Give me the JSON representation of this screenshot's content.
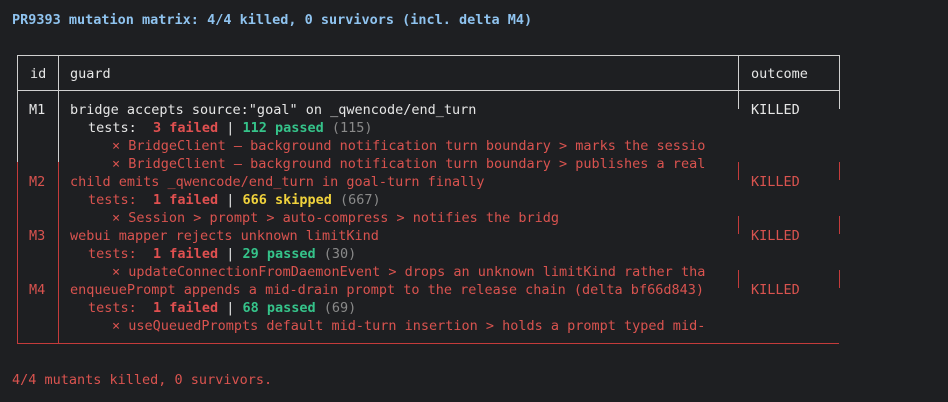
{
  "title": "PR9393 mutation matrix: 4/4 killed, 0 survivors (incl. delta M4)",
  "headers": {
    "id": "id",
    "guard": "guard",
    "outcome": "outcome"
  },
  "rows": [
    {
      "id": "M1",
      "guard": "bridge accepts source:\"goal\" on _qwencode/end_turn",
      "outcome": "KILLED",
      "tests_label": "tests:",
      "failed": "3 failed",
      "sep": "|",
      "second": "112 passed",
      "total": "(115)",
      "failures": [
        "× BridgeClient — background notification turn boundary > marks the sessio",
        "× BridgeClient — background notification turn boundary > publishes a real"
      ]
    },
    {
      "id": "M2",
      "guard": "child emits _qwencode/end_turn in goal-turn finally",
      "outcome": "KILLED",
      "tests_label": "tests:",
      "failed": "1 failed",
      "sep": "|",
      "second": "666 skipped",
      "total": "(667)",
      "failures": [
        "× Session > prompt > auto-compress > notifies the bridg"
      ]
    },
    {
      "id": "M3",
      "guard": "webui mapper rejects unknown limitKind",
      "outcome": "KILLED",
      "tests_label": "tests:",
      "failed": "1 failed",
      "sep": "|",
      "second": "29 passed",
      "total": "(30)",
      "failures": [
        "× updateConnectionFromDaemonEvent > drops an unknown limitKind rather tha"
      ]
    },
    {
      "id": "M4",
      "guard": "enqueuePrompt appends a mid-drain prompt to the release chain (delta bf66d843)",
      "outcome": "KILLED",
      "tests_label": "tests:",
      "failed": "1 failed",
      "sep": "|",
      "second": "68 passed",
      "total": "(69)",
      "failures": [
        "× useQueuedPrompts default mid-turn insertion > holds a prompt typed mid-"
      ]
    }
  ],
  "footer": "4/4 mutants killed, 0 survivors."
}
